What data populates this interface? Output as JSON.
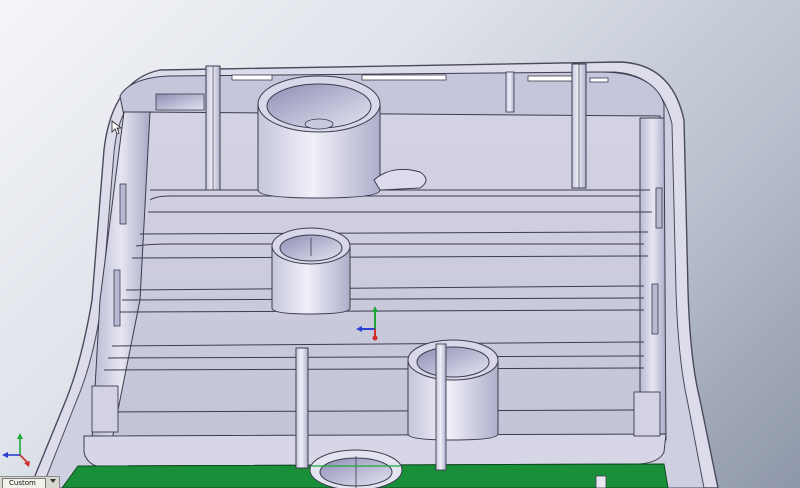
{
  "viewport": {
    "background_top": "#f4f5f8",
    "background_bottom": "#8e97a9",
    "part_color": "#c9c9de",
    "pcb_color": "#1a8f3a"
  },
  "triad_main": {
    "x_axis_color": "#2b3fd1",
    "y_axis_color": "#1fa83a",
    "z_axis_color": "#d12b2b"
  },
  "triad_corner": {
    "x_axis_color": "#2b3fd1",
    "y_axis_color": "#1fa83a",
    "z_axis_color": "#d12b2b"
  },
  "tabs": {
    "custom_label": "Custom"
  }
}
